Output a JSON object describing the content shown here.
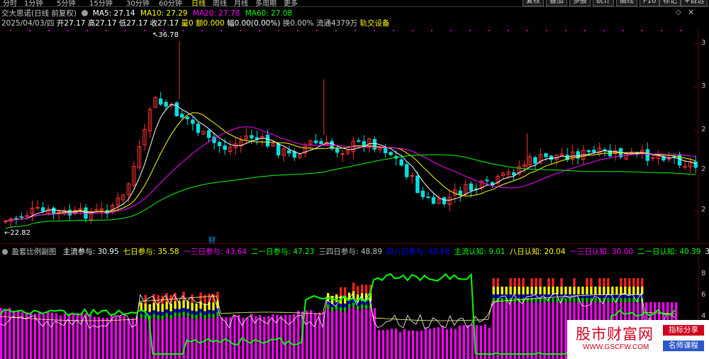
{
  "toolbar": {
    "timeframes": [
      "分时",
      "1分钟",
      "5分钟",
      "15分钟",
      "30分钟",
      "60分钟",
      "日线",
      "周线",
      "月线",
      "多周期",
      "更多"
    ],
    "active_timeframe": "日线",
    "right_buttons": [
      "复权",
      "叠加",
      "多股",
      "统计",
      "画线",
      "F10",
      "标记",
      "+自选"
    ]
  },
  "header": {
    "stock_title": "交大思诺(日线 前复权)",
    "ma5_label": "MA5: 27.14",
    "ma10_label": "MA10: 27.29",
    "ma20_label": "MA20: 27.78",
    "ma60_label": "MA60: 27.08",
    "date": "2025/04/03/四",
    "open": "开27.17",
    "high": "高27.17",
    "low": "低27.17",
    "close": "收27.17",
    "volume": "量0",
    "amount": "额0.000",
    "change": "幅0.00(0.00%)",
    "turnover": "换0.00%",
    "float": "流通4379万",
    "concept": "轨交设备"
  },
  "main_chart": {
    "high_marker": "36.78",
    "low_marker": "22.82",
    "event_marker": "财",
    "y_axis_labels": [
      "3",
      "3",
      "2",
      "2",
      "2"
    ]
  },
  "indicator": {
    "name": "盈套比例副图",
    "items": [
      {
        "label": "主流参与: 30.95",
        "color": "#ffffff"
      },
      {
        "label": "七日参与: 35.58",
        "color": "#ffff00"
      },
      {
        "label": "一三日参与: 43.64",
        "color": "#ff00ff"
      },
      {
        "label": "二一日参与: 47.23",
        "color": "#00ff00"
      },
      {
        "label": "三四日参与: 48.89",
        "color": "#c0c0c0"
      },
      {
        "label": "四八日参与: 48.68",
        "color": "#0000ff"
      },
      {
        "label": "主流认知: 9.01",
        "color": "#00ff00"
      },
      {
        "label": "八日认知: 20.04",
        "color": "#ffff00"
      },
      {
        "label": "一三日认知: 30.00",
        "color": "#ff00ff"
      },
      {
        "label": "二一日认知: 40.39",
        "color": "#00ff00"
      },
      {
        "label": "3",
        "color": "#ffffff"
      }
    ],
    "y_axis_labels": [
      "8",
      "6",
      "4"
    ]
  },
  "watermark": {
    "name": "股市财富网",
    "url": "WWW.GSCFW.COM",
    "badge1": "指标分享",
    "badge2": "名师课程"
  },
  "colors": {
    "up": "#ff3030",
    "down": "#00e0e0",
    "ma5": "#ffffff",
    "ma10": "#ffff00",
    "ma20": "#ff00ff",
    "ma60": "#00ff00"
  }
}
